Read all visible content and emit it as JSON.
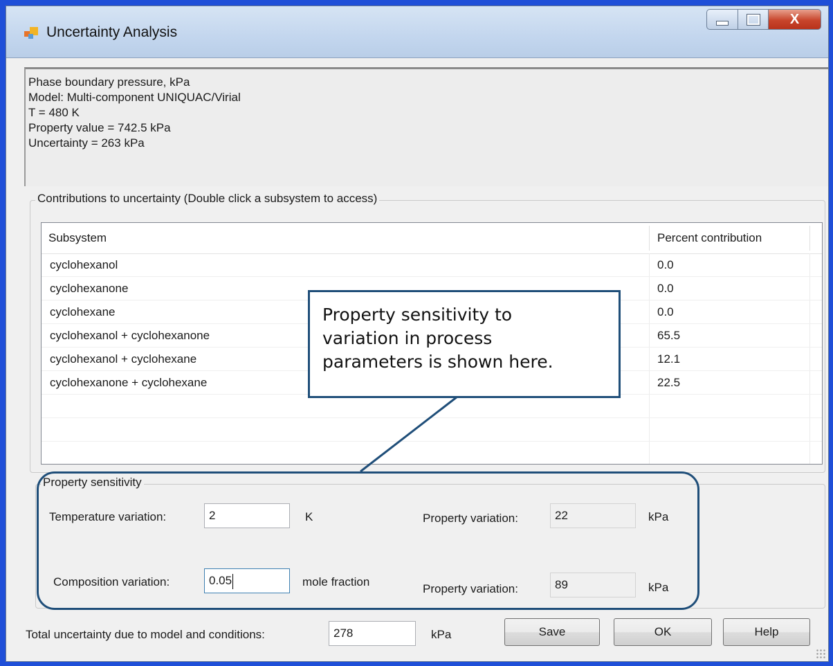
{
  "window": {
    "title": "Uncertainty Analysis",
    "close_glyph": "X"
  },
  "info": {
    "lines": [
      "Phase boundary pressure, kPa",
      "Model: Multi-component UNIQUAC/Virial",
      "T = 480 K",
      "Property value = 742.5 kPa",
      "Uncertainty = 263 kPa"
    ]
  },
  "contributions": {
    "group_label": "Contributions to uncertainty (Double click a subsystem to access)",
    "columns": [
      "Subsystem",
      "Percent contribution"
    ],
    "rows": [
      [
        "cyclohexanol",
        "0.0"
      ],
      [
        "cyclohexanone",
        "0.0"
      ],
      [
        "cyclohexane",
        "0.0"
      ],
      [
        "cyclohexanol + cyclohexanone",
        "65.5"
      ],
      [
        "cyclohexanol + cyclohexane",
        "12.1"
      ],
      [
        "cyclohexanone + cyclohexane",
        "22.5"
      ]
    ]
  },
  "sensitivity": {
    "group_label": "Property sensitivity",
    "temperature_label": "Temperature variation:",
    "temperature_value": "2",
    "temperature_unit": "K",
    "composition_label": "Composition variation:",
    "composition_value": "0.05",
    "composition_unit": "mole fraction",
    "property_label_1": "Property variation:",
    "property_value_1": "22",
    "property_unit_1": "kPa",
    "property_label_2": "Property variation:",
    "property_value_2": "89",
    "property_unit_2": "kPa"
  },
  "footer": {
    "total_label": "Total uncertainty due to model and conditions:",
    "total_value": "278",
    "total_unit": "kPa",
    "save_label": "Save",
    "ok_label": "OK",
    "help_label": "Help"
  },
  "callout": {
    "lines": [
      "Property sensitivity to",
      "variation in process",
      "parameters is shown here."
    ]
  },
  "colors": {
    "background": "#1f4fd8",
    "callout_border": "#1f4e79"
  }
}
